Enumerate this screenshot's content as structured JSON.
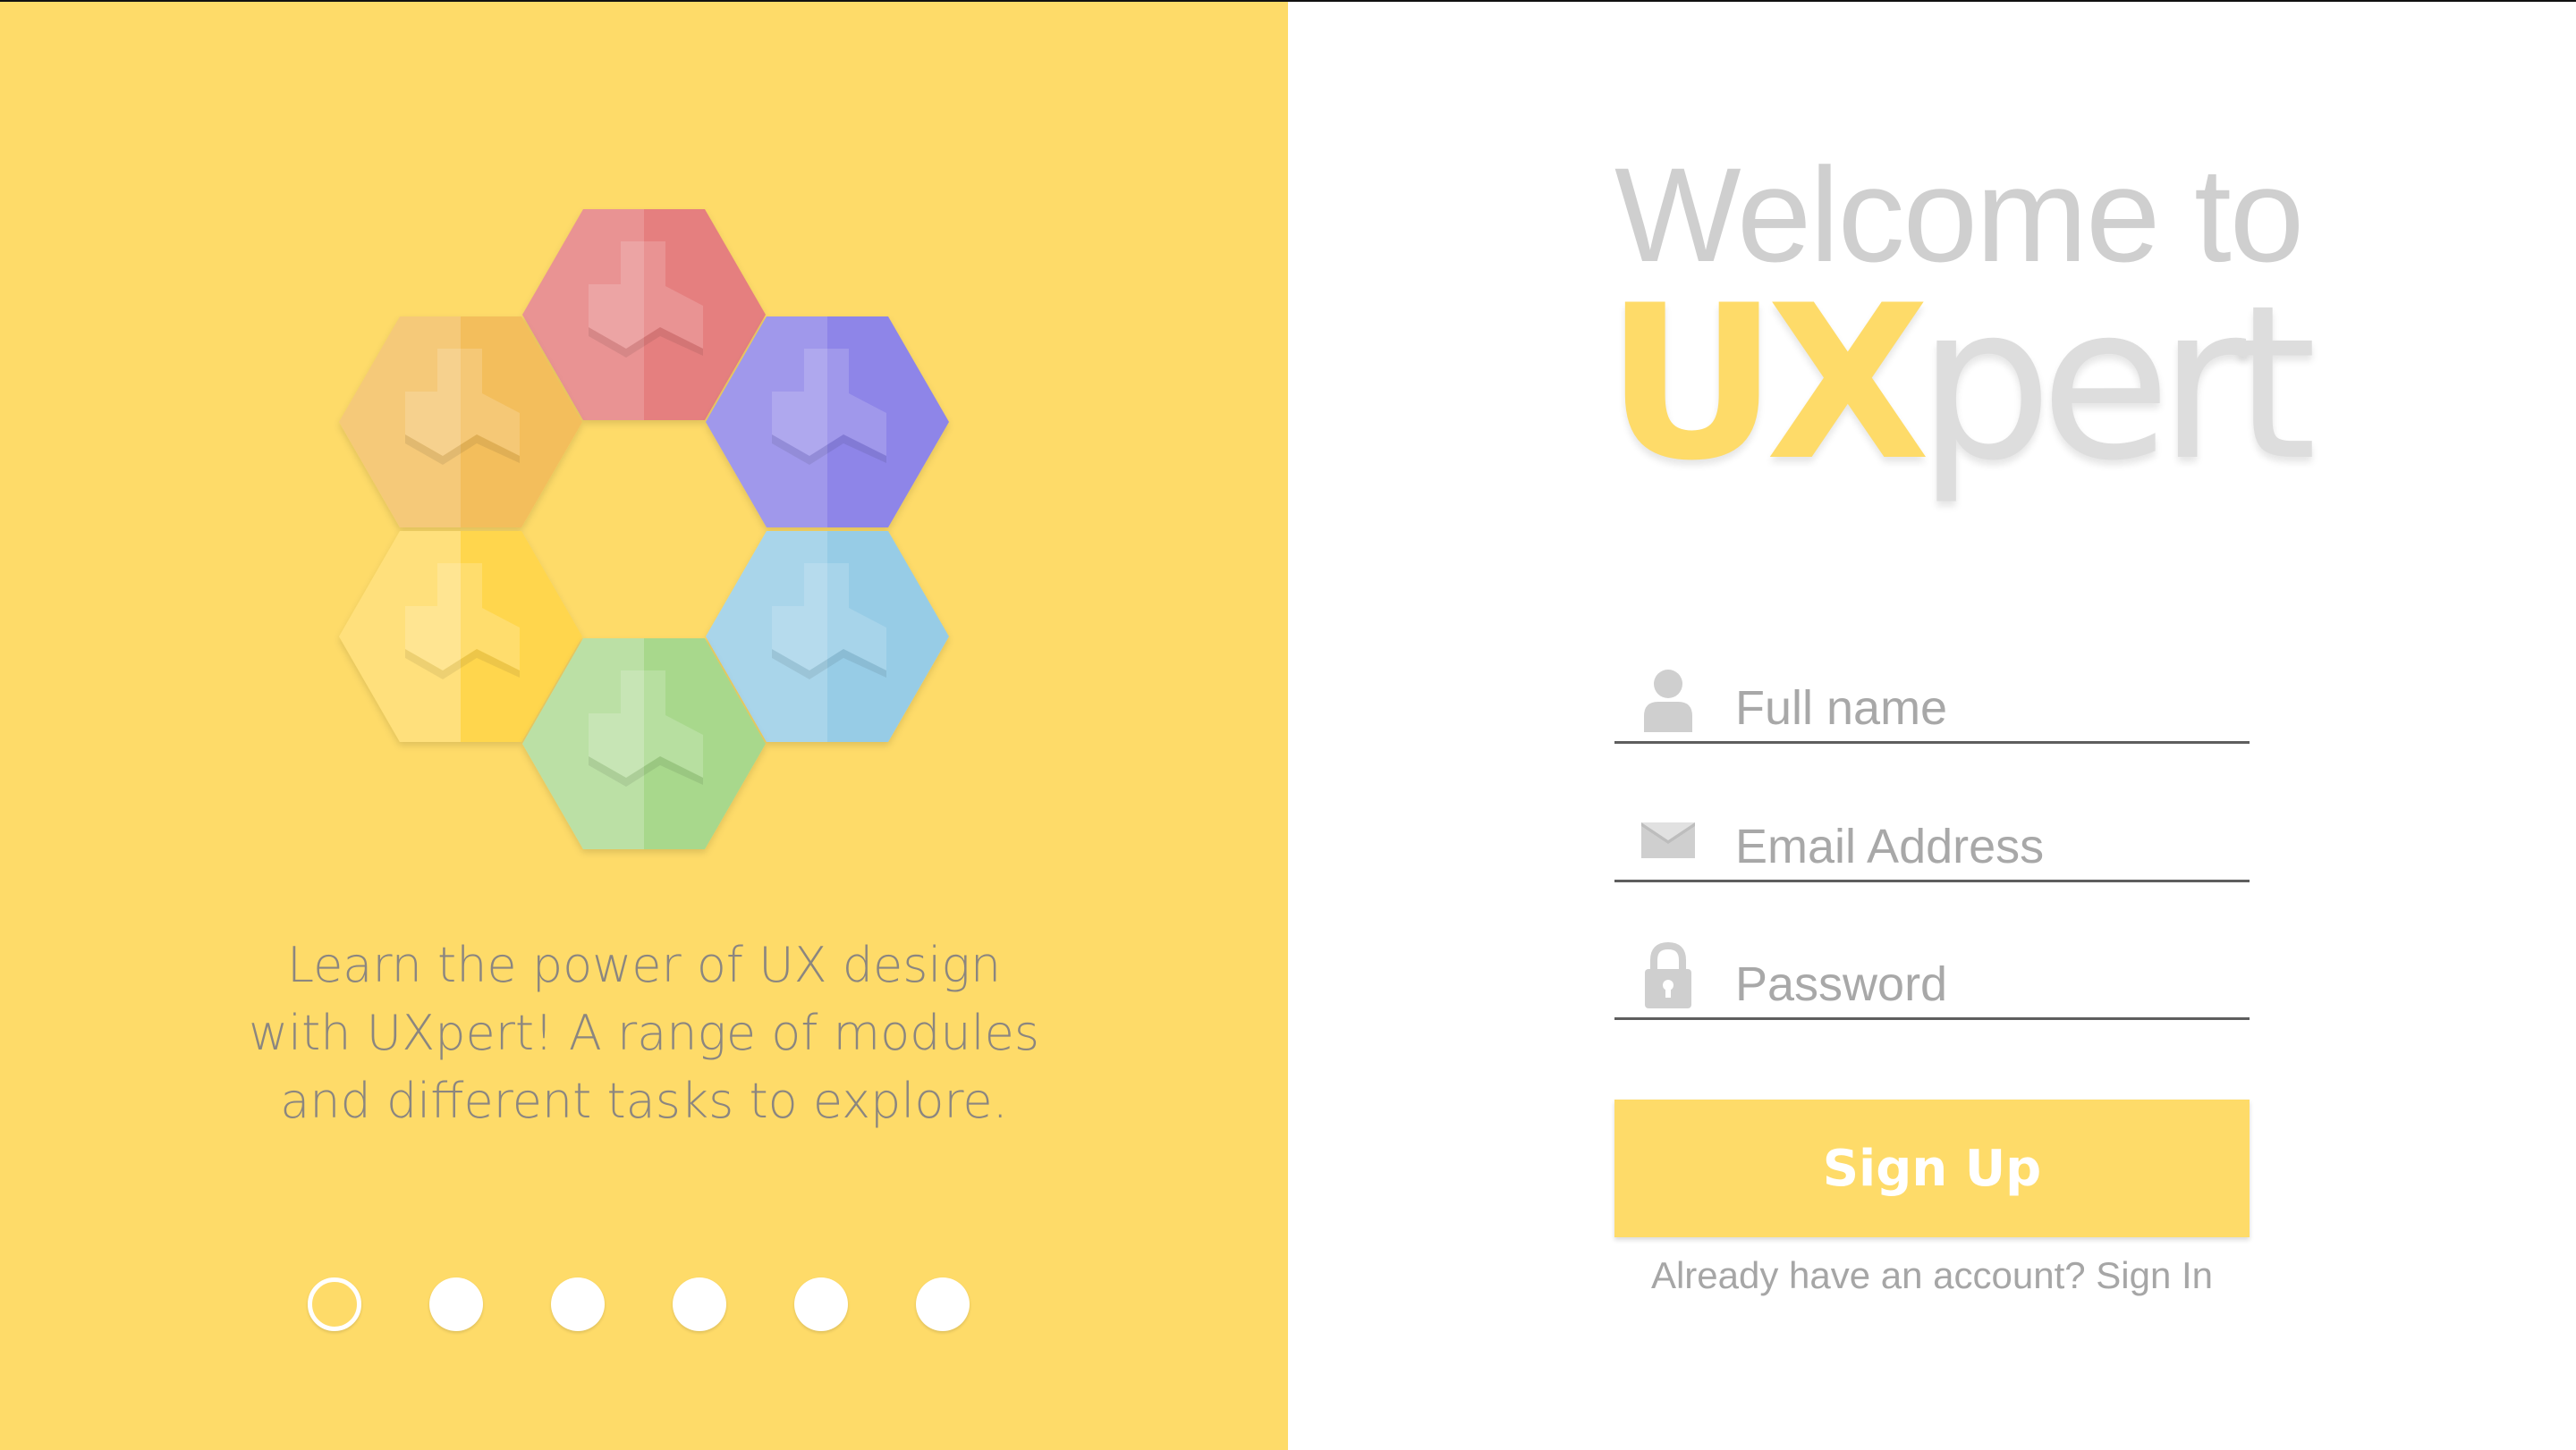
{
  "app": {
    "welcome_text": "Welcome to",
    "brand_ux": "UX",
    "brand_pert": "pert"
  },
  "onboarding": {
    "tagline_lines": [
      "Learn the power of UX design",
      "with UXpert! A range of modules",
      "and different tasks to explore."
    ],
    "pagination": {
      "total": 6,
      "active_index": 0
    },
    "logo_colors": [
      "#E57F7F",
      "#8E85E8",
      "#F3BE5C",
      "#97CCE6",
      "#FFD64E",
      "#A8D88C"
    ]
  },
  "form": {
    "full_name_placeholder": "Full name",
    "email_placeholder": "Email Address",
    "password_placeholder": "Password",
    "full_name_value": "",
    "email_value": "",
    "password_value": "",
    "signup_label": "Sign Up",
    "account_prompt": "Already have an account? ",
    "signin_label": "Sign In",
    "icons": {
      "full_name": "user-icon",
      "email": "envelope-icon",
      "password": "lock-icon"
    }
  },
  "colors": {
    "accent_yellow": "#FEDB69",
    "panel_white": "#FFFFFF",
    "muted_gray": "#CFCFCF",
    "text_gray": "#A6A6A6",
    "underline": "#5E5E5E"
  }
}
